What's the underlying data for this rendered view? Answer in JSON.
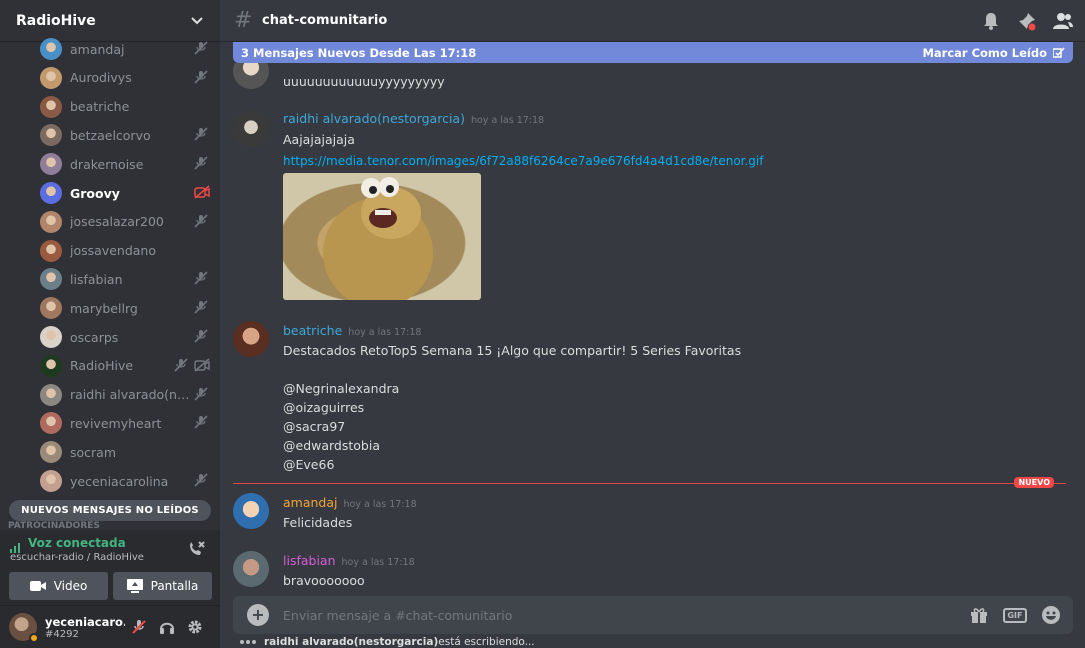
{
  "server": {
    "name": "RadioHive"
  },
  "members": [
    {
      "name": "amandaj",
      "mic_muted": true,
      "color": "#4a90c8"
    },
    {
      "name": "Aurodivys",
      "mic_muted": true,
      "color": "#c49a6c"
    },
    {
      "name": "beatriche",
      "mic_muted": false,
      "color": "#8a5a44"
    },
    {
      "name": "betzaelcorvo",
      "mic_muted": true,
      "color": "#7a6a60"
    },
    {
      "name": "drakernoise",
      "mic_muted": true,
      "color": "#8f7d9a"
    },
    {
      "name": "Groovy",
      "mic_muted": false,
      "video_off": true,
      "active": true,
      "color": "#5b6ee1"
    },
    {
      "name": "josesalazar200",
      "mic_muted": true,
      "color": "#b0856a"
    },
    {
      "name": "jossavendano",
      "mic_muted": false,
      "color": "#9a5a40"
    },
    {
      "name": "lisfabian",
      "mic_muted": true,
      "color": "#6a7f8a"
    },
    {
      "name": "marybellrg",
      "mic_muted": true,
      "color": "#a07860"
    },
    {
      "name": "oscarps",
      "mic_muted": true,
      "color": "#d8d2c8"
    },
    {
      "name": "RadioHive",
      "mic_muted": true,
      "video_off_grey": true,
      "color": "#1e3a1e"
    },
    {
      "name": "raidhi alvarado(nes...",
      "mic_muted": true,
      "color": "#8a8880"
    },
    {
      "name": "revivemyheart",
      "mic_muted": true,
      "color": "#b06a60"
    },
    {
      "name": "socram",
      "mic_muted": false,
      "color": "#9a8a7a"
    },
    {
      "name": "yeceniacarolina",
      "mic_muted": true,
      "color": "#c4a090"
    }
  ],
  "unread_pill": "NUEVOS MENSAJES NO LEÍDOS",
  "category_peek": "PATROCINADORES",
  "voice": {
    "status": "Voz conectada",
    "channel": "escuchar-radio / RadioHive",
    "video_label": "Video",
    "screen_label": "Pantalla"
  },
  "user": {
    "name": "yeceniacaro...",
    "tag": "#4292"
  },
  "channel": {
    "name": "chat-comunitario"
  },
  "new_messages_bar": {
    "text": "3 Mensajes Nuevos Desde Las 17:18",
    "mark_read": "Marcar Como Leído"
  },
  "messages": {
    "m0": {
      "text": "uuuuuuuuuuuuyyyyyyyyy"
    },
    "m1": {
      "author": "raidhi alvarado(nestorgarcia)",
      "author_color": "#3ea8db",
      "time": "hoy a las 17:18",
      "text": "Aajajajajaja",
      "link": "https://media.tenor.com/images/6f72a88f6264ce7a9e676fd4a4d1cd8e/tenor.gif"
    },
    "m2": {
      "author": "beatriche",
      "author_color": "#3ea8db",
      "time": "hoy a las 17:18",
      "lines": [
        "Destacados  RetoTop5 Semana 15 ¡Algo que compartir! 5 Series Favoritas",
        "@Negrinalexandra",
        "@oizaguirres",
        "@sacra97",
        "@edwardstobia",
        "@Eve66"
      ]
    },
    "divider_label": "NUEVO",
    "m3": {
      "author": "amandaj",
      "author_color": "#f0a63a",
      "time": "hoy a las 17:18",
      "text": "Felicidades"
    },
    "m4": {
      "author": "lisfabian",
      "author_color": "#d35fd6",
      "time": "hoy a las 17:18",
      "text": "bravooooooo"
    }
  },
  "composer": {
    "placeholder": "Enviar mensaje a #chat-comunitario",
    "gif_label": "GIF"
  },
  "typing": {
    "user": "raidhi alvarado(nestorgarcia)",
    "suffix": " está escribiendo..."
  },
  "colors": {
    "accent": "#7289da",
    "voice_green": "#43b581",
    "alert_red": "#f04747"
  }
}
